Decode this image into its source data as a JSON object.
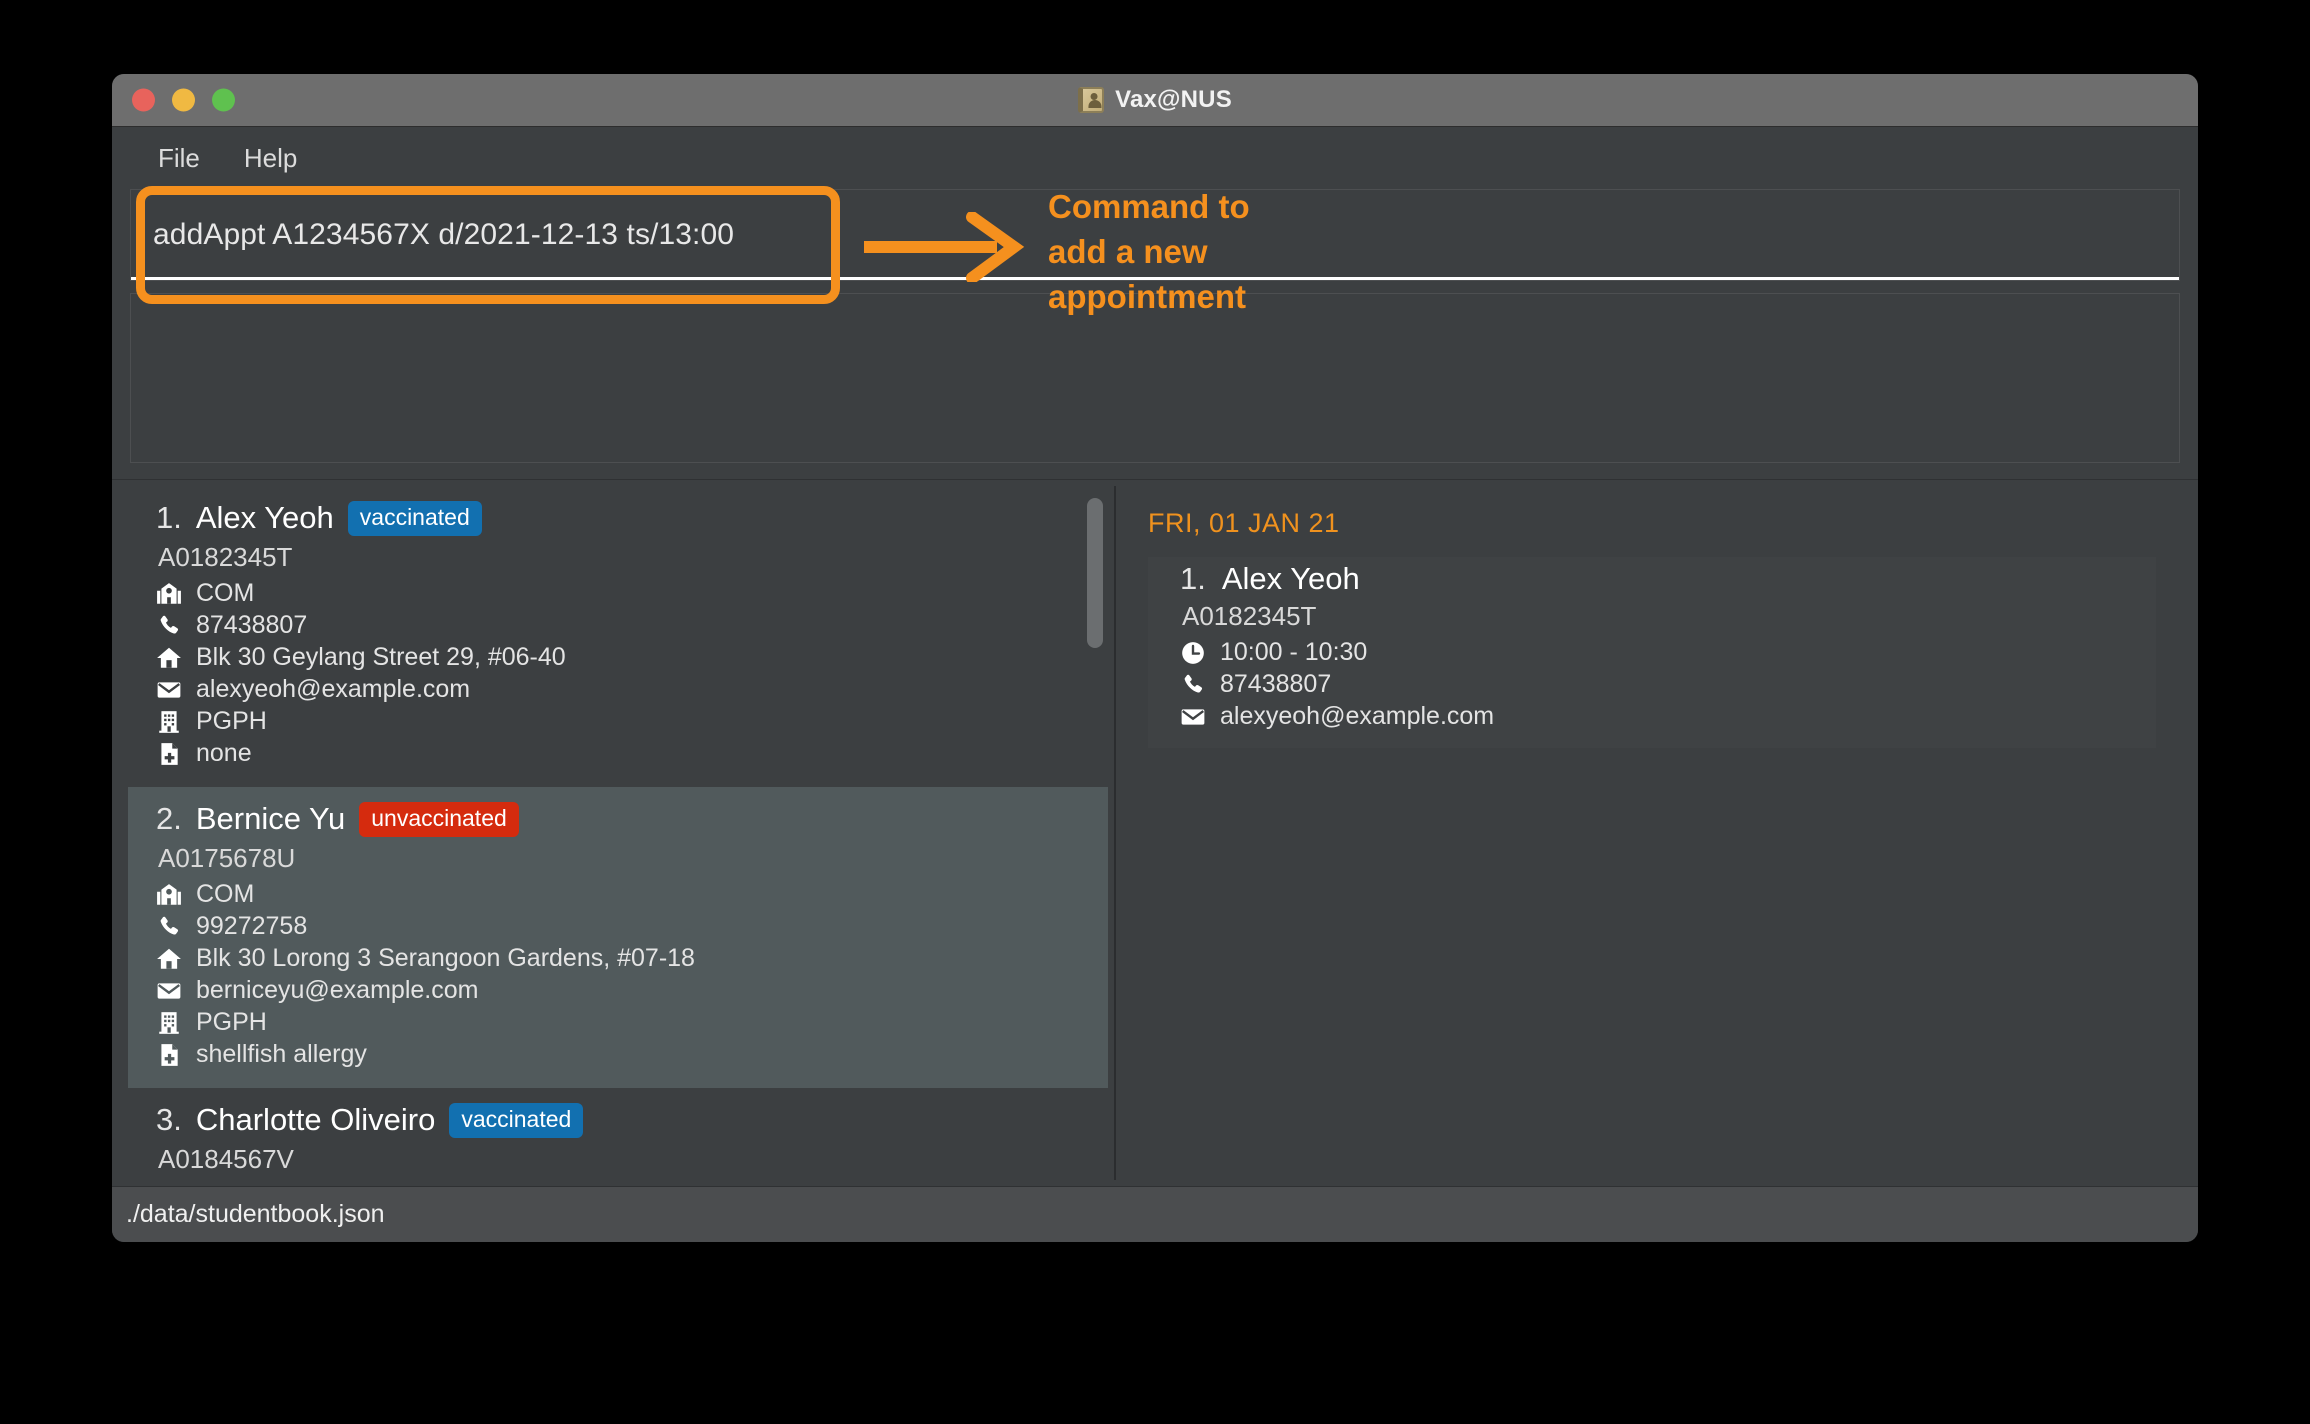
{
  "window": {
    "title": "Vax@NUS",
    "app_icon": "addressbook-icon",
    "traffic_lights": [
      {
        "name": "close-button",
        "color": "#e8635c"
      },
      {
        "name": "minimize-button",
        "color": "#f0b942"
      },
      {
        "name": "maximize-button",
        "color": "#5fc14f"
      }
    ]
  },
  "menubar": {
    "items": [
      {
        "label": "File"
      },
      {
        "label": "Help"
      }
    ]
  },
  "command_box": {
    "value": "addAppt A1234567X d/2021-12-13 ts/13:00",
    "placeholder": "Enter command here..."
  },
  "result_box": {
    "text": ""
  },
  "annotation": {
    "accent_color": "#f5901e",
    "lines": [
      "Command to",
      "add a new",
      "appointment"
    ],
    "arrow": "right-arrow-icon"
  },
  "person_list": {
    "persons": [
      {
        "index": "1.",
        "name": "Alex Yeoh",
        "status": "vaccinated",
        "status_color": "#1270b0",
        "id": "A0182345T",
        "selected": false,
        "details": [
          {
            "icon": "faculty-icon",
            "value": "COM"
          },
          {
            "icon": "phone-icon",
            "value": "87438807"
          },
          {
            "icon": "home-icon",
            "value": "Blk 30 Geylang Street 29, #06-40"
          },
          {
            "icon": "email-icon",
            "value": "alexyeoh@example.com"
          },
          {
            "icon": "building-icon",
            "value": "PGPH"
          },
          {
            "icon": "medical-icon",
            "value": "none"
          }
        ]
      },
      {
        "index": "2.",
        "name": "Bernice Yu",
        "status": "unvaccinated",
        "status_color": "#d52b0e",
        "id": "A0175678U",
        "selected": true,
        "details": [
          {
            "icon": "faculty-icon",
            "value": "COM"
          },
          {
            "icon": "phone-icon",
            "value": "99272758"
          },
          {
            "icon": "home-icon",
            "value": "Blk 30 Lorong 3 Serangoon Gardens, #07-18"
          },
          {
            "icon": "email-icon",
            "value": "berniceyu@example.com"
          },
          {
            "icon": "building-icon",
            "value": "PGPH"
          },
          {
            "icon": "medical-icon",
            "value": "shellfish allergy"
          }
        ]
      },
      {
        "index": "3.",
        "name": "Charlotte Oliveiro",
        "status": "vaccinated",
        "status_color": "#1270b0",
        "id": "A0184567V",
        "selected": false,
        "details": []
      }
    ]
  },
  "appointment_panel": {
    "date_header": "FRI, 01 JAN 21",
    "appointments": [
      {
        "index": "1.",
        "name": "Alex Yeoh",
        "id": "A0182345T",
        "details": [
          {
            "icon": "clock-icon",
            "value": "10:00 - 10:30"
          },
          {
            "icon": "phone-icon",
            "value": "87438807"
          },
          {
            "icon": "email-icon",
            "value": "alexyeoh@example.com"
          }
        ]
      }
    ]
  },
  "statusbar": {
    "path": "./data/studentbook.json"
  }
}
